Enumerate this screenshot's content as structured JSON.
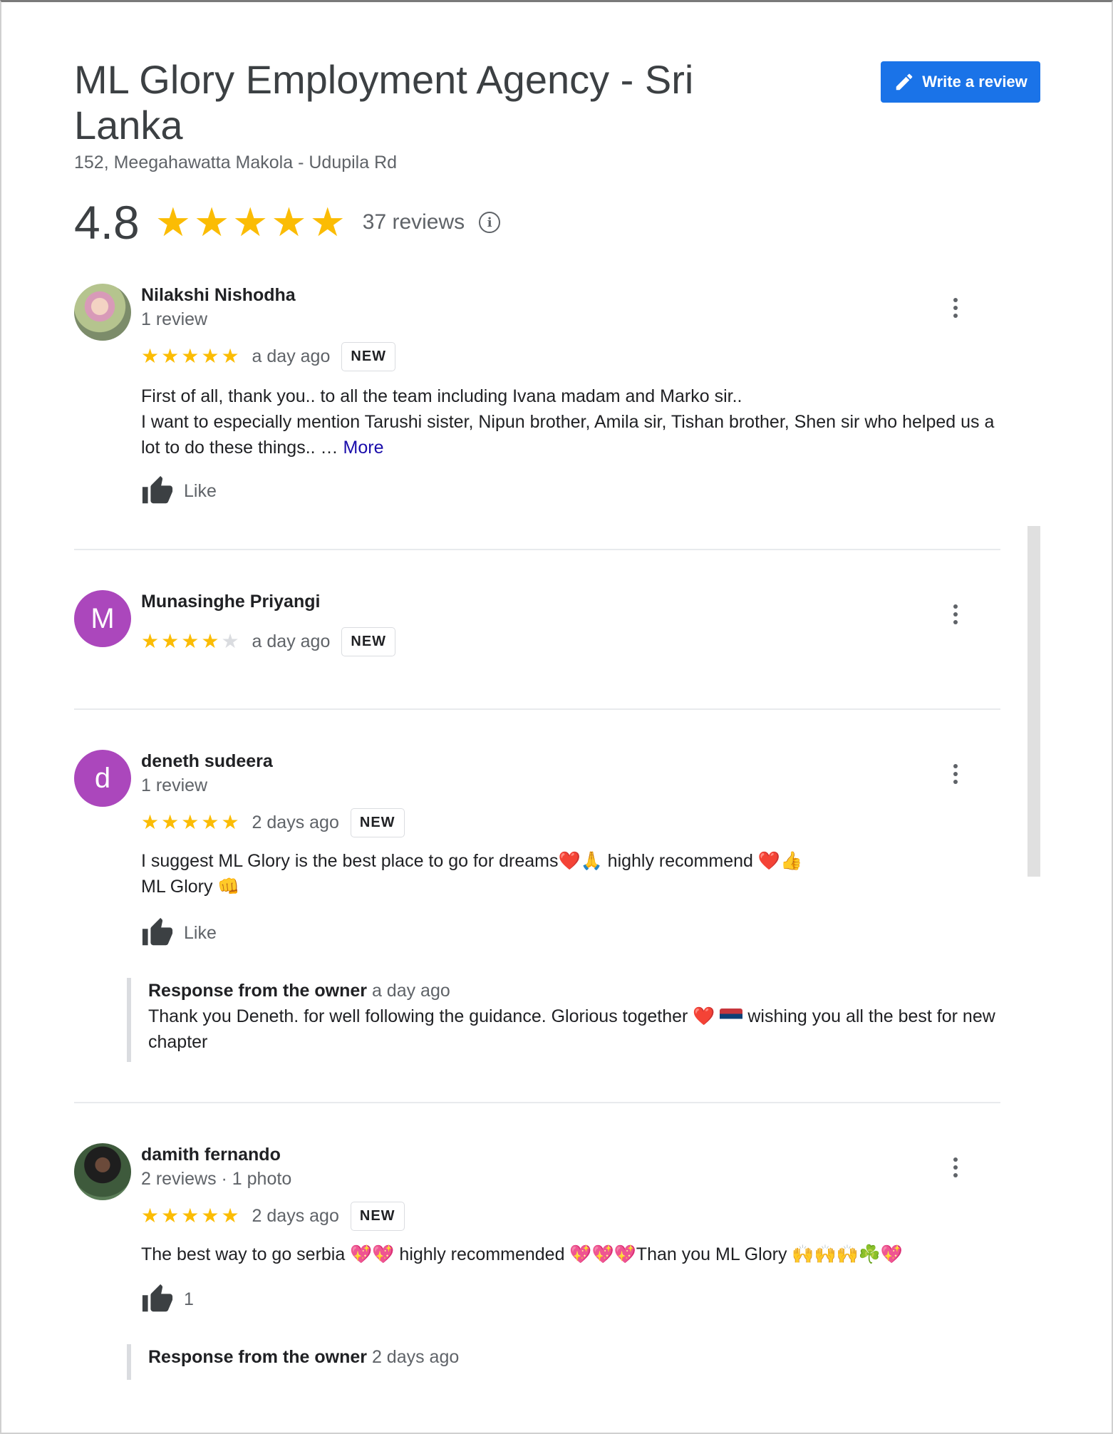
{
  "business": {
    "title": "ML Glory Employment Agency - Sri Lanka",
    "address": "152, Meegahawatta Makola - Udupila Rd",
    "rating": "4.8",
    "stars": 5,
    "reviews_count": "37 reviews",
    "write_review_label": "Write a review"
  },
  "colors": {
    "accent": "#1a73e8",
    "star": "#fbbc04",
    "avatar_letter_bg": "#ab47bc"
  },
  "icons": [
    "pencil-icon",
    "star-icon",
    "info-icon",
    "more-vert-icon",
    "thumbs-up-icon"
  ],
  "reviews": [
    {
      "name": "Nilakshi Nishodha",
      "meta": "1 review",
      "rating": 5,
      "date": "a day ago",
      "badge": "NEW",
      "text_line1": "First of all, thank you.. to all the team including Ivana madam and Marko sir..",
      "text_line2": "I want to especially mention Tarushi sister, Nipun brother, Amila sir, Tishan brother, Shen sir who helped us a lot to do these things.. …",
      "more_label": "More",
      "like_label": "Like"
    },
    {
      "name": "Munasinghe Priyangi",
      "avatar_letter": "M",
      "rating": 4,
      "date": "a day ago",
      "badge": "NEW"
    },
    {
      "name": "deneth sudeera",
      "avatar_letter": "d",
      "meta": "1 review",
      "rating": 5,
      "date": "2 days ago",
      "badge": "NEW",
      "text_line1": "I suggest ML Glory is the best place to go for dreams❤️🙏 highly recommend ❤️👍",
      "text_line2": "ML Glory 👊",
      "like_label": "Like",
      "owner_label": "Response from the owner",
      "owner_date": "a day ago",
      "owner_text_a": "Thank you Deneth. for well following the guidance. Glorious together ❤️",
      "owner_text_b": "wishing you all the best for new chapter"
    },
    {
      "name": "damith fernando",
      "meta": "2 reviews · 1 photo",
      "rating": 5,
      "date": "2 days ago",
      "badge": "NEW",
      "text_line1": "The best way to go serbia 💖💖 highly recommended 💖💖💖Than you ML Glory 🙌🙌🙌☘️💖",
      "like_count": "1",
      "owner_label": "Response from the owner",
      "owner_date": "2 days ago"
    }
  ]
}
